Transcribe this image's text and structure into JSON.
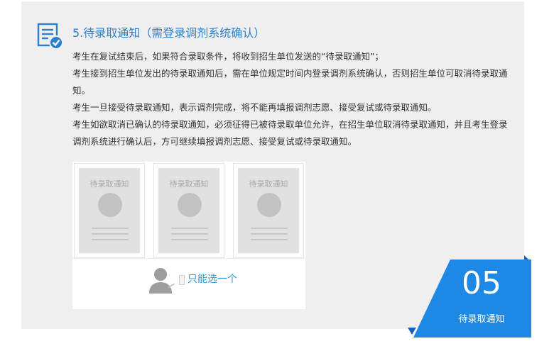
{
  "step": {
    "title": "5.待录取通知（需登录调剂系统确认）",
    "icon": "document-check-icon"
  },
  "description": [
    "考生在复试结束后，如果符合录取条件，将收到招生单位发送的“待录取通知”；",
    "考生接到招生单位发出的待录取通知后，需在单位规定时间内登录调剂系统确认，否则招生单位可取消待录取通知。",
    "考生一旦接受待录取通知，表示调剂完成，将不能再填报调剂志愿、接受复试或待录取通知。",
    "考生如欲取消已确认的待录取通知，必须征得已被待录取单位允许，在招生单位取消待录取通知，并且考生登录调剂系统进行确认后，方可继续填报调剂志愿、接受复试或待录取通知。"
  ],
  "illustration": {
    "cards": [
      {
        "label": "待录取通知"
      },
      {
        "label": "待录取通知"
      },
      {
        "label": "待录取通知"
      }
    ],
    "choice_label": "只能选一个",
    "person_icon": "user-icon"
  },
  "badge": {
    "number": "05",
    "label": "待录取通知"
  },
  "colors": {
    "accent_blue": "#1e88e5",
    "title_blue": "#2a7fcf",
    "choice_blue": "#2a9fd6",
    "panel_bg": "#efefef"
  }
}
